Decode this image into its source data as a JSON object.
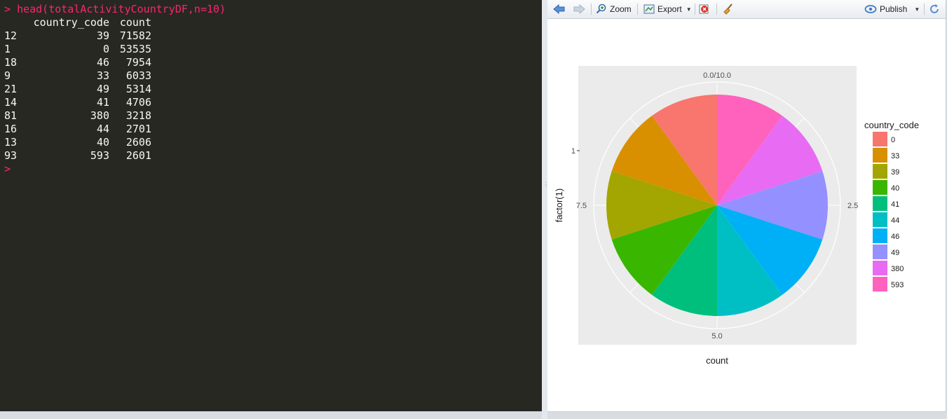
{
  "console": {
    "prompt": ">",
    "command": "head(totalActivityCountryDF,n=10)",
    "header": {
      "index": "",
      "country_code": "country_code",
      "count": "count"
    },
    "rows": [
      {
        "index": "12",
        "country_code": "39",
        "count": "71582"
      },
      {
        "index": "1",
        "country_code": "0",
        "count": "53535"
      },
      {
        "index": "18",
        "country_code": "46",
        "count": "7954"
      },
      {
        "index": "9",
        "country_code": "33",
        "count": "6033"
      },
      {
        "index": "21",
        "country_code": "49",
        "count": "5314"
      },
      {
        "index": "14",
        "country_code": "41",
        "count": "4706"
      },
      {
        "index": "81",
        "country_code": "380",
        "count": "3218"
      },
      {
        "index": "16",
        "country_code": "44",
        "count": "2701"
      },
      {
        "index": "13",
        "country_code": "40",
        "count": "2606"
      },
      {
        "index": "93",
        "country_code": "593",
        "count": "2601"
      }
    ],
    "end_prompt": ">"
  },
  "toolbar": {
    "zoom_label": "Zoom",
    "export_label": "Export",
    "publish_label": "Publish",
    "icons": [
      "back-arrow-icon",
      "forward-arrow-icon",
      "zoom-icon",
      "export-icon",
      "remove-plot-icon",
      "broom-icon",
      "publish-icon",
      "refresh-icon"
    ]
  },
  "chart_data": {
    "type": "pie",
    "title": "",
    "xlabel": "count",
    "ylabel": "factor(1)",
    "y_tick_labels": [
      "1"
    ],
    "theta_tick_labels": [
      "0.0/10.0",
      "2.5",
      "5.0",
      "7.5"
    ],
    "theta_range": [
      0,
      10
    ],
    "legend_title": "country_code",
    "legend_position": "right",
    "panel_background": "#ebebeb",
    "grid": true,
    "slices": [
      {
        "label": "0",
        "value": 1,
        "color": "#F8766D"
      },
      {
        "label": "33",
        "value": 1,
        "color": "#D89000"
      },
      {
        "label": "39",
        "value": 1,
        "color": "#A3A500"
      },
      {
        "label": "40",
        "value": 1,
        "color": "#39B600"
      },
      {
        "label": "41",
        "value": 1,
        "color": "#00BF7D"
      },
      {
        "label": "44",
        "value": 1,
        "color": "#00BFC4"
      },
      {
        "label": "46",
        "value": 1,
        "color": "#00B0F6"
      },
      {
        "label": "49",
        "value": 1,
        "color": "#9590FF"
      },
      {
        "label": "380",
        "value": 1,
        "color": "#E76BF3"
      },
      {
        "label": "593",
        "value": 1,
        "color": "#FF62BC"
      }
    ]
  }
}
